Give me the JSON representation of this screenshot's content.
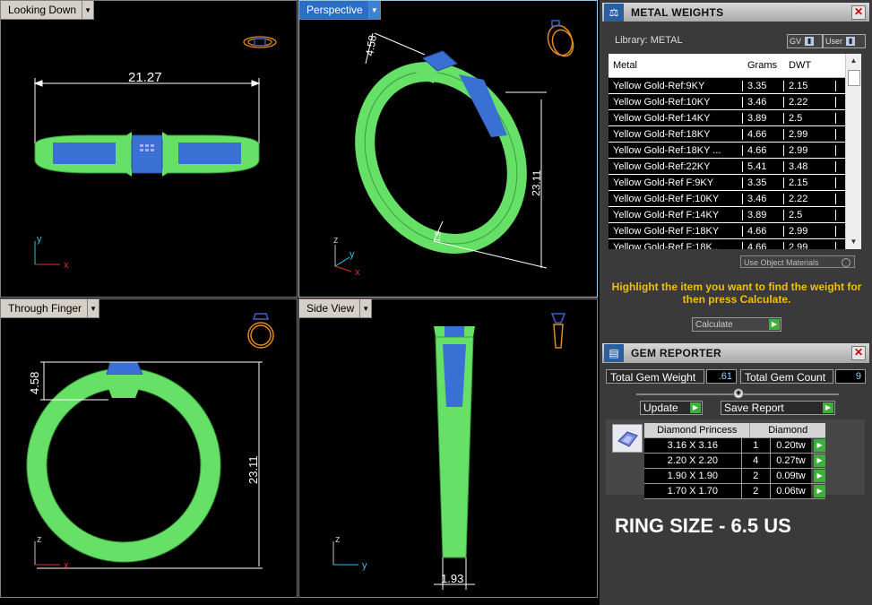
{
  "viewports": {
    "top_left": {
      "tab": "Looking Down",
      "dim": "21.27",
      "axes": [
        "y",
        "x"
      ]
    },
    "top_right": {
      "tab": "Perspective",
      "dims": [
        "4.58",
        "23.11",
        "1.9"
      ],
      "axes": [
        "z",
        "y",
        "x"
      ]
    },
    "bottom_left": {
      "tab": "Through Finger",
      "dims": [
        "4.58",
        "23.11"
      ],
      "axes": [
        "z",
        "x"
      ]
    },
    "bottom_right": {
      "tab": "Side View",
      "dim": "1.93",
      "axes": [
        "z",
        "y"
      ]
    }
  },
  "metal_weights": {
    "title": "METAL WEIGHTS",
    "library": "Library: METAL",
    "gv": "GV",
    "user": "User",
    "headers": {
      "metal": "Metal",
      "grams": "Grams",
      "dwt": "DWT"
    },
    "rows": [
      {
        "metal": "Yellow Gold-Ref:9KY",
        "grams": "3.35",
        "dwt": "2.15"
      },
      {
        "metal": "Yellow Gold-Ref:10KY",
        "grams": "3.46",
        "dwt": "2.22"
      },
      {
        "metal": "Yellow Gold-Ref:14KY",
        "grams": "3.89",
        "dwt": "2.5"
      },
      {
        "metal": "Yellow Gold-Ref:18KY",
        "grams": "4.66",
        "dwt": "2.99"
      },
      {
        "metal": "Yellow Gold-Ref:18KY ...",
        "grams": "4.66",
        "dwt": "2.99"
      },
      {
        "metal": "Yellow Gold-Ref:22KY",
        "grams": "5.41",
        "dwt": "3.48"
      },
      {
        "metal": "Yellow Gold-Ref F:9KY",
        "grams": "3.35",
        "dwt": "2.15"
      },
      {
        "metal": "Yellow Gold-Ref F:10KY",
        "grams": "3.46",
        "dwt": "2.22"
      },
      {
        "metal": "Yellow Gold-Ref F:14KY",
        "grams": "3.89",
        "dwt": "2.5"
      },
      {
        "metal": "Yellow Gold-Ref F:18KY",
        "grams": "4.66",
        "dwt": "2.99"
      },
      {
        "metal": "Yellow Gold-Ref F:18K...",
        "grams": "4.66",
        "dwt": "2.99"
      }
    ],
    "use_object_materials": "Use Object Materials",
    "highlight_text": "Highlight the item you want to find the weight for then press Calculate.",
    "calculate": "Calculate"
  },
  "gem_reporter": {
    "title": "GEM REPORTER",
    "total_weight_label": "Total Gem Weight",
    "total_weight_value": ".61",
    "total_count_label": "Total Gem Count",
    "total_count_value": "9",
    "update": "Update",
    "save_report": "Save Report",
    "table_header": {
      "shape": "Diamond Princess",
      "material": "Diamond"
    },
    "rows": [
      {
        "size": "3.16 X 3.16",
        "count": "1",
        "tw": "0.20tw"
      },
      {
        "size": "2.20 X 2.20",
        "count": "4",
        "tw": "0.27tw"
      },
      {
        "size": "1.90 X 1.90",
        "count": "2",
        "tw": "0.09tw"
      },
      {
        "size": "1.70 X 1.70",
        "count": "2",
        "tw": "0.06tw"
      }
    ],
    "ring_size": "RING SIZE - 6.5 US"
  },
  "colors": {
    "ring": "#66e066",
    "gem": "#3a6fd4",
    "dim_line": "#ffffff",
    "highlight": "#f0c000",
    "axis_x": "#e03030",
    "axis_y": "#30c0e0",
    "axis_z": "#c0c0c0"
  }
}
